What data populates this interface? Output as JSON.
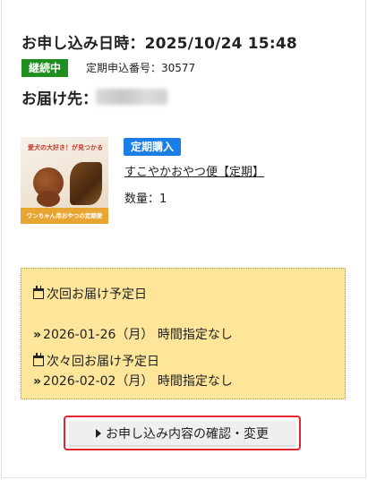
{
  "order": {
    "date_label": "お申し込み日時：2025/10/24 15:48",
    "status": "継続中",
    "subscription_no": "定期申込番号：30577",
    "ship_to_label": "お届け先："
  },
  "product": {
    "badge": "定期購入",
    "name": "すこやかおやつ便【定期】",
    "quantity": "数量：1",
    "image_caption": "愛犬の大好き！が見つかる",
    "image_band": "ワンちゃん用おやつの定期便"
  },
  "delivery": {
    "next_label": "次回お届け予定日",
    "next_value": "2026-01-26（月） 時間指定なし",
    "after_next_label": "次々回お届け予定日",
    "after_next_value": "2026-02-02（月） 時間指定なし",
    "arrow": "»"
  },
  "actions": {
    "change_label": "お申し込み内容の確認・変更"
  },
  "colors": {
    "status_green": "#1e8f1e",
    "badge_blue": "#1a7ee6",
    "delivery_bg": "#fde59a",
    "button_border": "#e0262f"
  }
}
